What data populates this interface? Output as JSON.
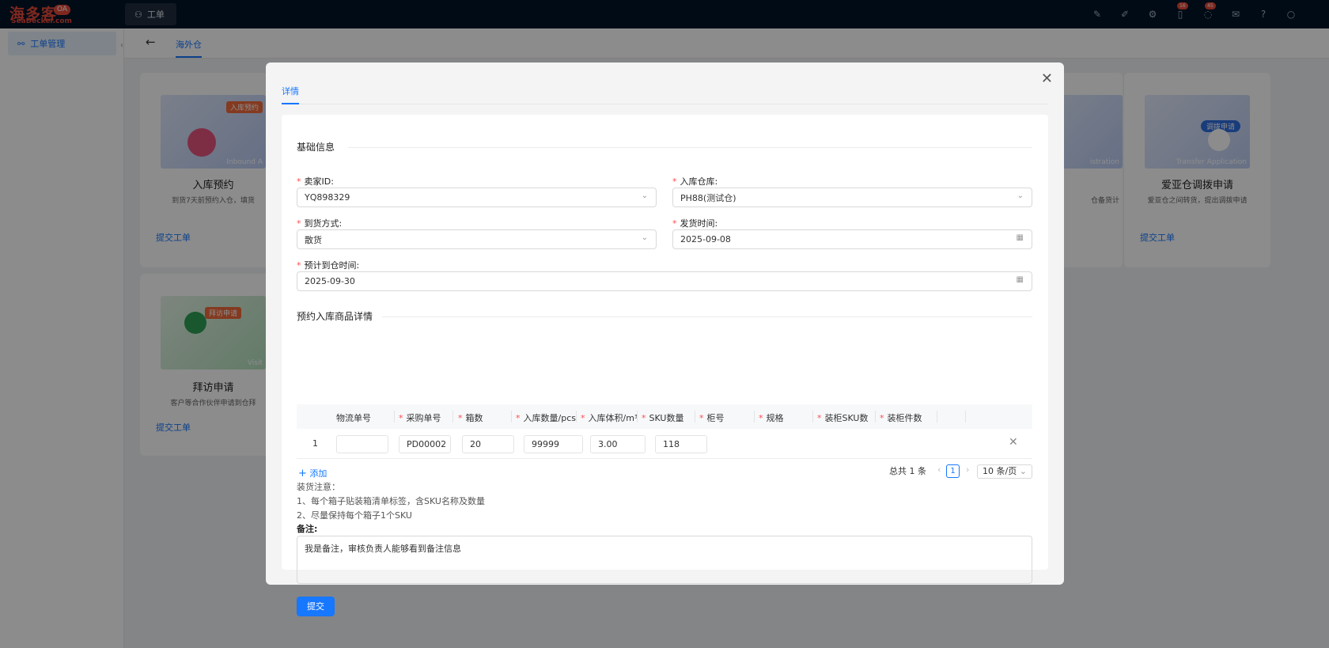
{
  "app": {
    "logo_cn": "海多客",
    "logo_en": "SeaDecker.com",
    "logo_badge": "OA",
    "top_tab": "工单",
    "badges": {
      "bell": "16",
      "msg": "45"
    }
  },
  "sidebar": {
    "item": "工单管理"
  },
  "subnav": {
    "tab": "海外仓"
  },
  "cards": [
    {
      "title": "入库预约",
      "desc": "到货7天前预约入仓，填货",
      "link": "提交工单",
      "tag": "入库预约",
      "en": "Inbound A"
    },
    {
      "title": "爱亚仓调拨申请",
      "desc": "爱亚仓之间转货，提出调拨申请",
      "link": "提交工单",
      "tag": "调拨申请",
      "en": "Transfer Application"
    },
    {
      "title": "拜访申请",
      "desc": "客户等合作伙伴申请到仓拜",
      "link": "提交工单",
      "tag": "拜访申请",
      "en": "Visit"
    },
    {
      "desc": "仓备货计",
      "en": "istration"
    }
  ],
  "modal": {
    "tab": "详情",
    "section_basic": "基础信息",
    "fields": {
      "seller_id": {
        "label": "卖家ID:",
        "value": "YQ898329"
      },
      "warehouse": {
        "label": "入库仓库:",
        "value": "PH88(测试仓)"
      },
      "arrival": {
        "label": "到货方式:",
        "value": "散货"
      },
      "ship_time": {
        "label": "发货时间:",
        "value": "2025-09-08"
      },
      "eta": {
        "label": "预计到仓时间:",
        "value": "2025-09-30"
      }
    },
    "section_goods": "预约入库商品详情",
    "columns": [
      "物流单号",
      "采购单号",
      "箱数",
      "入库数量/pcs",
      "入库体积/m³",
      "SKU数量",
      "柜号",
      "规格",
      "装柜SKU数",
      "装柜件数"
    ],
    "row": {
      "index": "1",
      "logistics_no": "",
      "po_no": "PD00002",
      "boxes": "20",
      "qty": "99999",
      "volume": "3.00",
      "sku": "118"
    },
    "add": "添加",
    "pager": {
      "total": "总共 1 条",
      "page": "1",
      "size": "10 条/页"
    },
    "notes": [
      "装货注意：",
      "1、每个箱子贴装箱清单标签，含SKU名称及数量",
      "2、尽量保持每个箱子1个SKU"
    ],
    "remark_label": "备注:",
    "remark_value": "我是备注，审核负责人能够看到备注信息",
    "submit": "提交"
  }
}
